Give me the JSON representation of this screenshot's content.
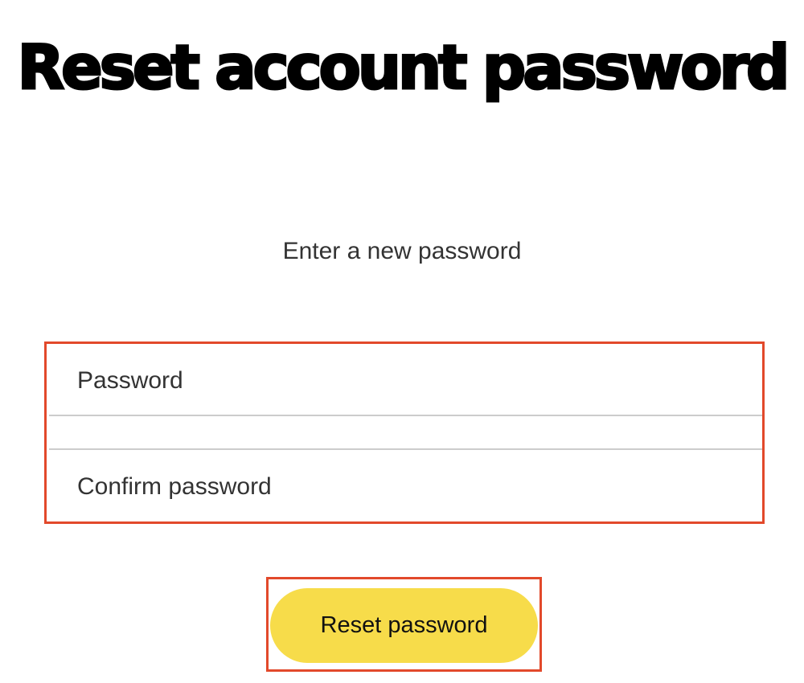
{
  "page": {
    "title": "Reset account password",
    "subtitle": "Enter a new password"
  },
  "form": {
    "password": {
      "placeholder": "Password",
      "value": ""
    },
    "confirm_password": {
      "placeholder": "Confirm password",
      "value": ""
    },
    "submit_label": "Reset password"
  },
  "colors": {
    "button_background": "#f7dc4a",
    "highlight_border": "#e2492b",
    "title_text": "#000000",
    "body_text": "#333333",
    "divider": "#cccccc"
  }
}
